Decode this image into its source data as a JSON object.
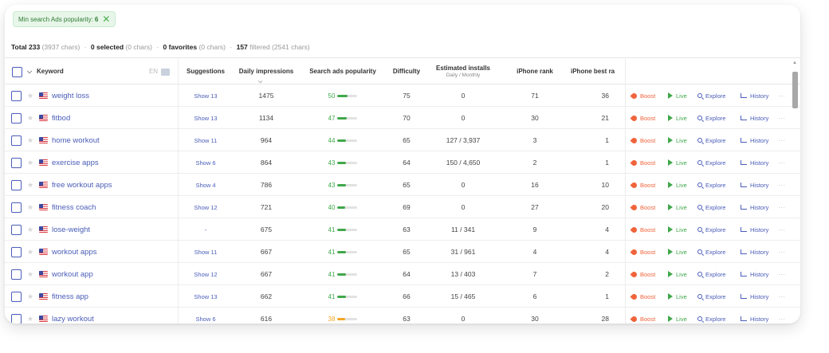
{
  "filter": {
    "label": "Min search Ads popularity:",
    "value": "6",
    "close": "✕"
  },
  "totals": {
    "total_label": "Total 233",
    "total_chars": "(3937 chars)",
    "selected_label": "0 selected",
    "selected_chars": "(0 chars)",
    "favorites_label": "0 favorites",
    "favorites_chars": "(0 chars)",
    "filtered_count": "157",
    "filtered_text": "filtered (2541 chars)",
    "sep": "·"
  },
  "columns": {
    "keyword": "Keyword",
    "lang": "EN",
    "suggestions": "Suggestions",
    "impressions": "Daily impressions",
    "popularity": "Search ads popularity",
    "difficulty": "Difficulty",
    "installs": "Estimated installs",
    "installs_sub": "Daily / Monthly",
    "rank": "iPhone rank",
    "best_rank": "iPhone best ra"
  },
  "actions": {
    "boost": "Boost",
    "live": "Live",
    "explore": "Explore",
    "history": "History",
    "more": "···"
  },
  "colors": {
    "accent": "#4a5db8",
    "green": "#3fa84a",
    "orange": "#f5a623",
    "boost": "#f0643c"
  },
  "rows": [
    {
      "keyword": "weight loss",
      "suggestions": "Show 13",
      "impressions": "1475",
      "popularity": "50",
      "popularity_level": 0.5,
      "difficulty": "75",
      "installs": "0",
      "rank": "71",
      "best": "36"
    },
    {
      "keyword": "fitbod",
      "suggestions": "Show 13",
      "impressions": "1134",
      "popularity": "47",
      "popularity_level": 0.47,
      "difficulty": "70",
      "installs": "0",
      "rank": "30",
      "best": "21"
    },
    {
      "keyword": "home workout",
      "suggestions": "Show 11",
      "impressions": "964",
      "popularity": "44",
      "popularity_level": 0.44,
      "difficulty": "65",
      "installs": "127 / 3,937",
      "rank": "3",
      "best": "1"
    },
    {
      "keyword": "exercise apps",
      "suggestions": "Show 6",
      "impressions": "864",
      "popularity": "43",
      "popularity_level": 0.43,
      "difficulty": "64",
      "installs": "150 / 4,650",
      "rank": "2",
      "best": "1"
    },
    {
      "keyword": "free workout apps",
      "suggestions": "Show 4",
      "impressions": "786",
      "popularity": "43",
      "popularity_level": 0.43,
      "difficulty": "65",
      "installs": "0",
      "rank": "16",
      "best": "10"
    },
    {
      "keyword": "fitness coach",
      "suggestions": "Show 12",
      "impressions": "721",
      "popularity": "40",
      "popularity_level": 0.4,
      "difficulty": "69",
      "installs": "0",
      "rank": "27",
      "best": "20"
    },
    {
      "keyword": "lose-weight",
      "suggestions": "-",
      "impressions": "675",
      "popularity": "41",
      "popularity_level": 0.41,
      "difficulty": "63",
      "installs": "11 / 341",
      "rank": "9",
      "best": "4"
    },
    {
      "keyword": "workout apps",
      "suggestions": "Show 11",
      "impressions": "667",
      "popularity": "41",
      "popularity_level": 0.41,
      "difficulty": "65",
      "installs": "31 / 961",
      "rank": "4",
      "best": "4"
    },
    {
      "keyword": "workout app",
      "suggestions": "Show 12",
      "impressions": "667",
      "popularity": "41",
      "popularity_level": 0.41,
      "difficulty": "64",
      "installs": "13 / 403",
      "rank": "7",
      "best": "2"
    },
    {
      "keyword": "fitness app",
      "suggestions": "Show 13",
      "impressions": "662",
      "popularity": "41",
      "popularity_level": 0.41,
      "difficulty": "66",
      "installs": "15 / 465",
      "rank": "6",
      "best": "1"
    },
    {
      "keyword": "lazy workout",
      "suggestions": "Show 6",
      "impressions": "616",
      "popularity": "38",
      "popularity_level": 0.38,
      "difficulty": "63",
      "installs": "0",
      "rank": "30",
      "best": "28"
    }
  ]
}
